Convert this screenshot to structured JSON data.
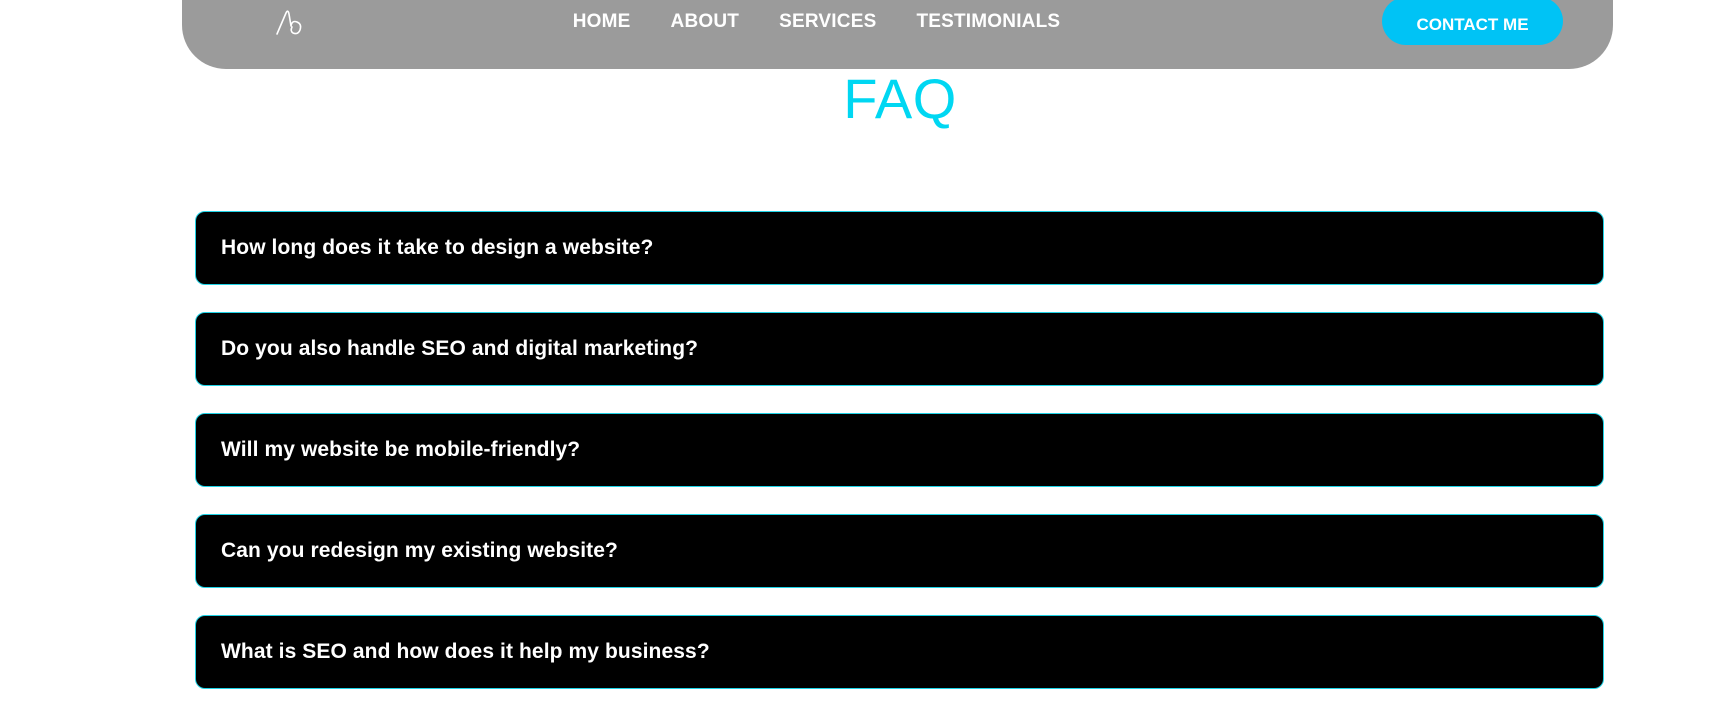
{
  "navbar": {
    "logo_icon": "signature-logo-icon",
    "links": [
      {
        "label": "HOME"
      },
      {
        "label": "ABOUT"
      },
      {
        "label": "SERVICES"
      },
      {
        "label": "TESTIMONIALS"
      }
    ],
    "contact_label": "CONTACT ME"
  },
  "faq": {
    "title": "FAQ",
    "items": [
      {
        "question": "How long does it take to design a website?"
      },
      {
        "question": "Do you also handle SEO and digital marketing?"
      },
      {
        "question": "Will my website be mobile-friendly?"
      },
      {
        "question": "Can you redesign my existing website?"
      },
      {
        "question": "What is SEO and how does it help my business?"
      }
    ]
  },
  "colors": {
    "navbar_bg": "#9b9b9b",
    "accent": "#00c3f5",
    "title": "#00d7f2",
    "item_bg": "#000000",
    "item_border": "#1fd3e6"
  }
}
